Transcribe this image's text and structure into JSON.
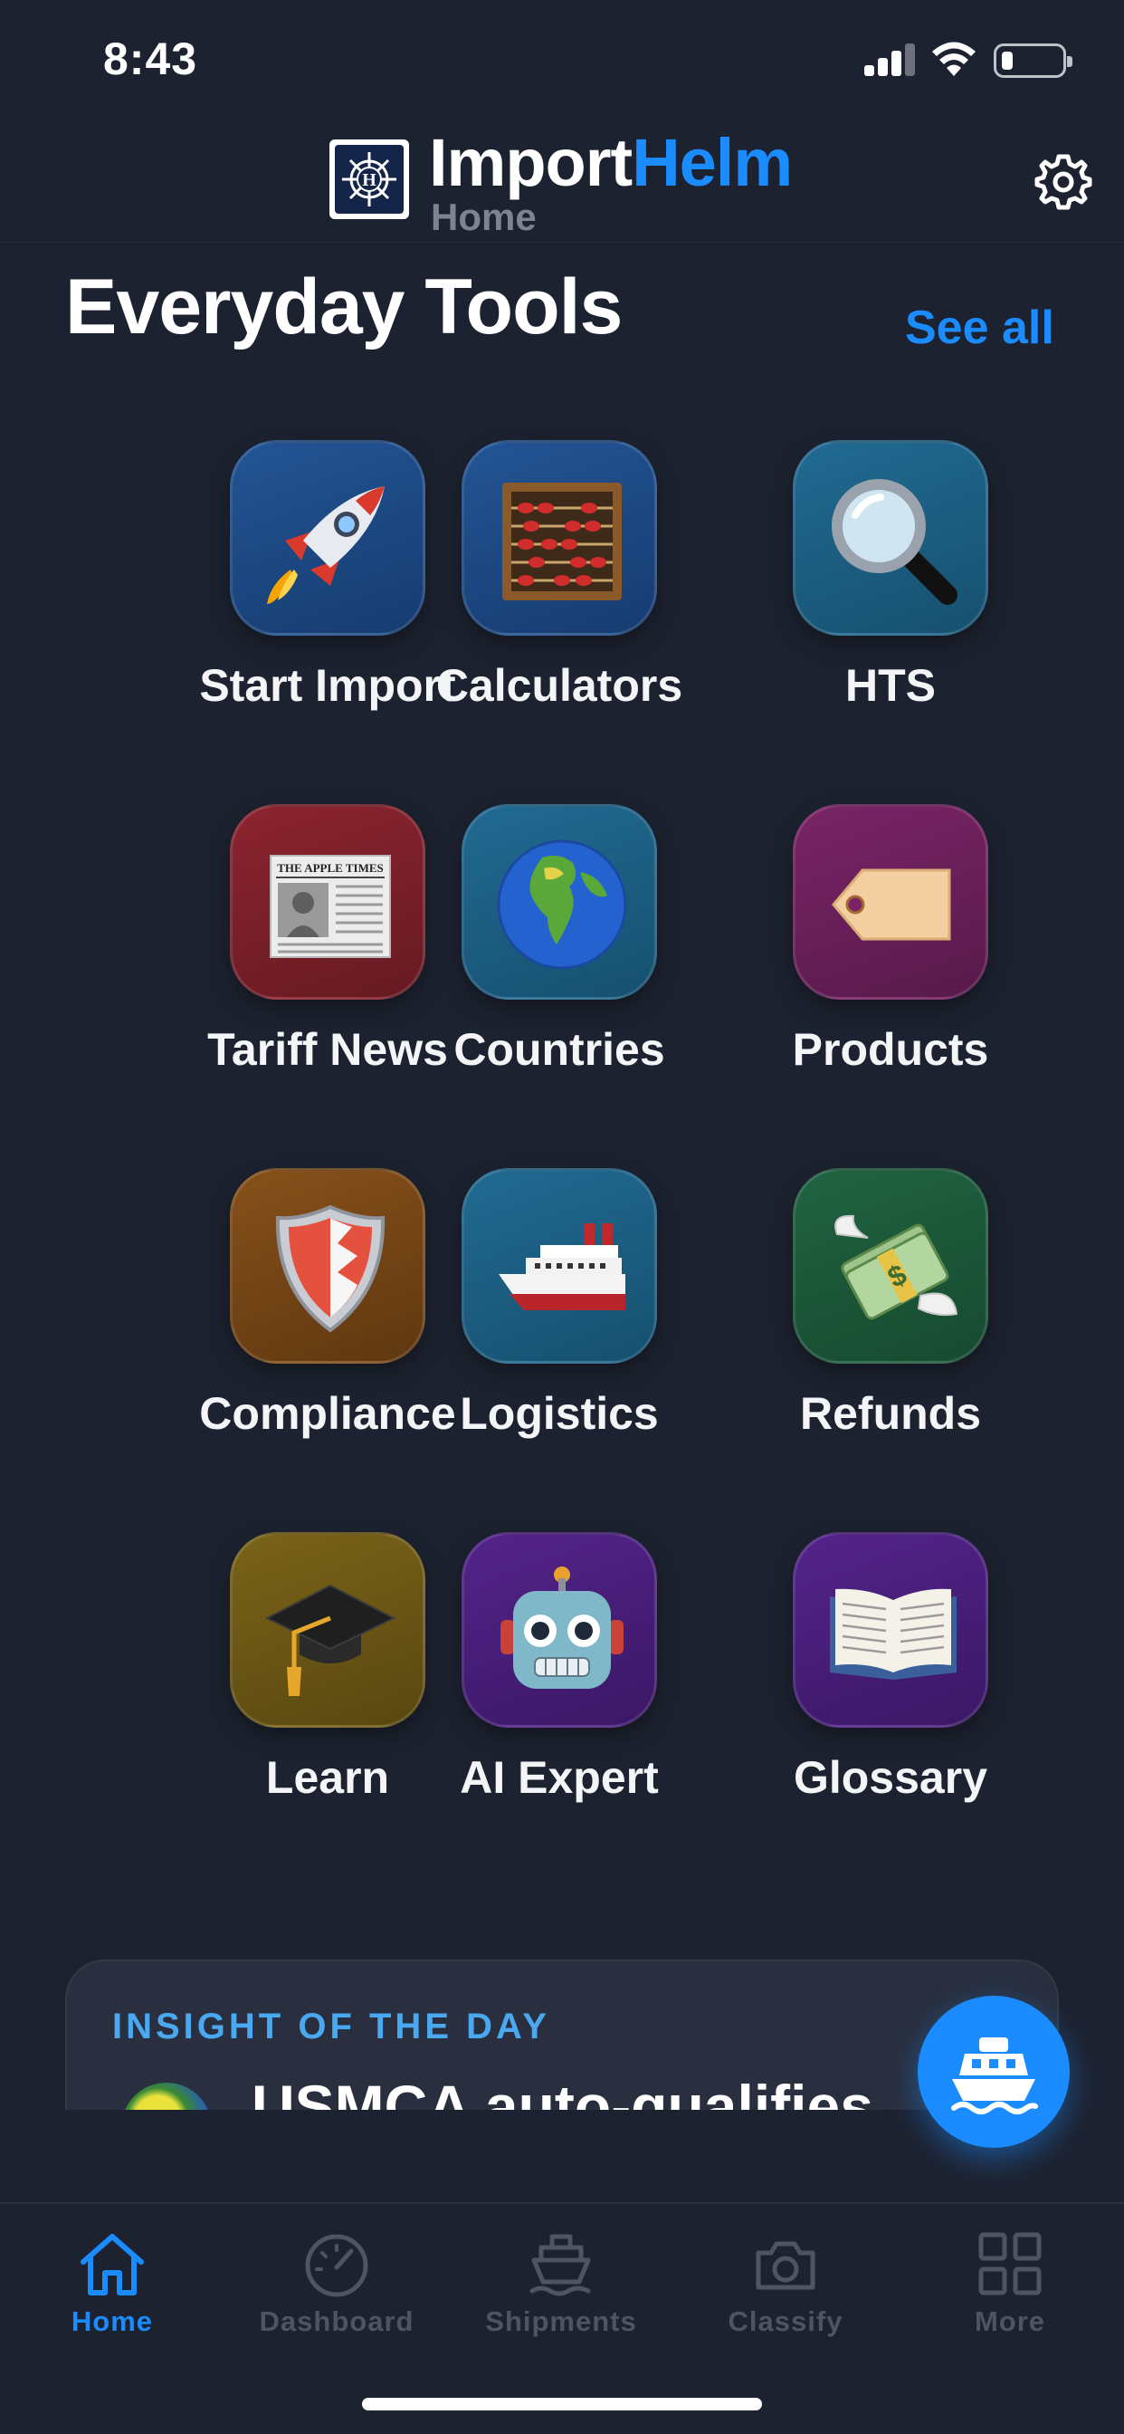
{
  "status_bar": {
    "time": "8:43"
  },
  "header": {
    "brand_part1": "Import",
    "brand_part2": "Helm",
    "subtitle": "Home",
    "logo_letter": "H"
  },
  "section": {
    "title": "Everyday Tools",
    "see_all_label": "See all"
  },
  "tools": [
    {
      "label": "Start Import",
      "icon": "rocket-icon",
      "color": "#1c4a86"
    },
    {
      "label": "Calculators",
      "icon": "abacus-icon",
      "color": "#1c4a86"
    },
    {
      "label": "HTS",
      "icon": "magnifying-glass-icon",
      "color": "#1a5f86"
    },
    {
      "label": "Tariff News",
      "icon": "newspaper-icon",
      "color": "#7a1f26"
    },
    {
      "label": "Countries",
      "icon": "globe-icon",
      "color": "#1a5f86"
    },
    {
      "label": "Products",
      "icon": "tag-icon",
      "color": "#6a1f55"
    },
    {
      "label": "Compliance",
      "icon": "shield-icon",
      "color": "#7a4613"
    },
    {
      "label": "Logistics",
      "icon": "ship-icon",
      "color": "#1a5f86"
    },
    {
      "label": "Refunds",
      "icon": "money-wings-icon",
      "color": "#1d5a3a"
    },
    {
      "label": "Learn",
      "icon": "graduation-cap-icon",
      "color": "#6e5512"
    },
    {
      "label": "AI Expert",
      "icon": "robot-icon",
      "color": "#4a1f7a"
    },
    {
      "label": "Glossary",
      "icon": "open-book-icon",
      "color": "#4a1f7a"
    }
  ],
  "newspaper_masthead": "THE APPLE TIMES",
  "insight": {
    "kicker": "INSIGHT OF THE DAY",
    "headline": "USMCA auto-qualifies"
  },
  "tab_bar": {
    "active": "Home",
    "tabs": [
      {
        "label": "Home",
        "icon": "house-icon"
      },
      {
        "label": "Dashboard",
        "icon": "speedometer-icon"
      },
      {
        "label": "Shipments",
        "icon": "ship-icon"
      },
      {
        "label": "Classify",
        "icon": "camera-icon"
      },
      {
        "label": "More",
        "icon": "grid-icon"
      }
    ]
  },
  "colors": {
    "accent": "#1b8cff",
    "background": "#1d2230",
    "tab_inactive": "#4d5463"
  }
}
